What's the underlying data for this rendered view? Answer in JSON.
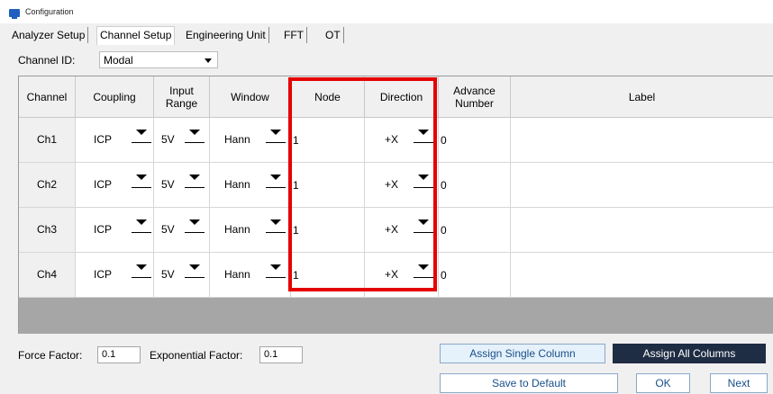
{
  "window": {
    "title": "Configuration",
    "accent": "#1f5fbf"
  },
  "tabs": [
    {
      "label": "Analyzer Setup"
    },
    {
      "label": "Channel Setup"
    },
    {
      "label": "Engineering Unit"
    },
    {
      "label": "FFT"
    },
    {
      "label": "OT"
    }
  ],
  "active_tab": "Channel Setup",
  "channel_id": {
    "label": "Channel ID:",
    "value": "Modal"
  },
  "table": {
    "headers": {
      "channel": "Channel",
      "coupling": "Coupling",
      "input_range": "Input Range",
      "window": "Window",
      "node": "Node",
      "direction": "Direction",
      "advance_number": "Advance Number",
      "label": "Label"
    },
    "rows": [
      {
        "channel": "Ch1",
        "coupling": "ICP",
        "input_range": "5V",
        "window": "Hann",
        "node": "1",
        "direction": "+X",
        "advance_number": "0",
        "label": ""
      },
      {
        "channel": "Ch2",
        "coupling": "ICP",
        "input_range": "5V",
        "window": "Hann",
        "node": "1",
        "direction": "+X",
        "advance_number": "0",
        "label": ""
      },
      {
        "channel": "Ch3",
        "coupling": "ICP",
        "input_range": "5V",
        "window": "Hann",
        "node": "1",
        "direction": "+X",
        "advance_number": "0",
        "label": ""
      },
      {
        "channel": "Ch4",
        "coupling": "ICP",
        "input_range": "5V",
        "window": "Hann",
        "node": "1",
        "direction": "+X",
        "advance_number": "0",
        "label": ""
      }
    ]
  },
  "highlight_color": "#e60000",
  "force_factor": {
    "label": "Force Factor:",
    "value": "0.1"
  },
  "exponential_factor": {
    "label": "Exponential Factor:",
    "value": "0.1"
  },
  "buttons": {
    "assign_single": "Assign Single Column",
    "assign_all": "Assign All Columns",
    "save_default": "Save to Default",
    "ok": "OK",
    "next": "Next"
  }
}
